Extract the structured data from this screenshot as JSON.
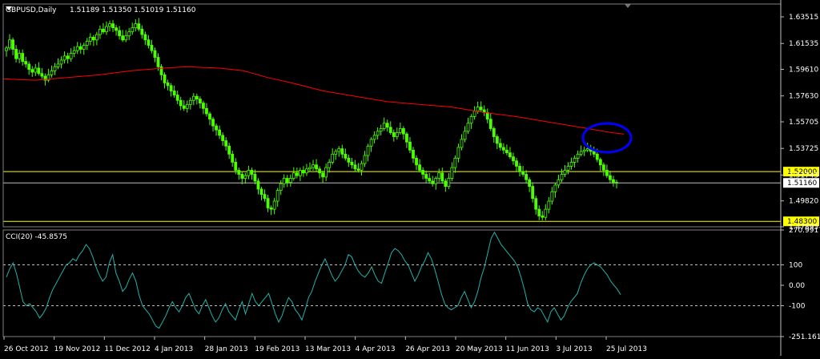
{
  "header": {
    "symbol_label": "GBPUSD,Daily",
    "ohlc": "1.51189 1.51350 1.51019 1.51160",
    "cci_label": "CCI(20) -45.8575"
  },
  "colors": {
    "background": "#000000",
    "candle": "#4cff00",
    "ma": "#ff0000",
    "hline": "#ffff00",
    "cci": "#20b2aa",
    "grid": "#c0c0c0",
    "text": "#ffffff",
    "circle": "#0000ff"
  },
  "chart_data": [
    {
      "type": "candlestick",
      "title": "GBPUSD,Daily",
      "x_tick_labels": [
        "26 Oct 2012",
        "19 Nov 2012",
        "11 Dec 2012",
        "4 Jan 2013",
        "28 Jan 2013",
        "19 Feb 2013",
        "13 Mar 2013",
        "4 Apr 2013",
        "26 Apr 2013",
        "20 May 2013",
        "11 Jun 2013",
        "3 Jul 2013",
        "25 Jul 2013"
      ],
      "y_tick_labels": [
        "1.63515",
        "1.61535",
        "1.59610",
        "1.57630",
        "1.55705",
        "1.53725",
        "1.51745",
        "1.49820",
        "1.47895"
      ],
      "ylim": [
        1.47895,
        1.6435
      ],
      "close_series": [
        1.612,
        1.618,
        1.611,
        1.604,
        1.608,
        1.602,
        1.6,
        1.596,
        1.594,
        1.597,
        1.593,
        1.591,
        1.588,
        1.592,
        1.595,
        1.598,
        1.6,
        1.603,
        1.606,
        1.604,
        1.608,
        1.61,
        1.613,
        1.611,
        1.614,
        1.617,
        1.62,
        1.618,
        1.622,
        1.626,
        1.624,
        1.628,
        1.63,
        1.627,
        1.625,
        1.621,
        1.618,
        1.621,
        1.624,
        1.627,
        1.63,
        1.626,
        1.622,
        1.618,
        1.614,
        1.61,
        1.605,
        1.598,
        1.592,
        1.586,
        1.584,
        1.58,
        1.577,
        1.573,
        1.569,
        1.567,
        1.57,
        1.573,
        1.576,
        1.574,
        1.571,
        1.567,
        1.563,
        1.559,
        1.554,
        1.551,
        1.547,
        1.543,
        1.539,
        1.533,
        1.527,
        1.521,
        1.518,
        1.515,
        1.517,
        1.521,
        1.518,
        1.513,
        1.507,
        1.503,
        1.5,
        1.493,
        1.492,
        1.498,
        1.506,
        1.511,
        1.515,
        1.512,
        1.515,
        1.519,
        1.517,
        1.521,
        1.519,
        1.522,
        1.523,
        1.525,
        1.522,
        1.519,
        1.516,
        1.523,
        1.527,
        1.533,
        1.535,
        1.537,
        1.533,
        1.53,
        1.527,
        1.525,
        1.522,
        1.521,
        1.526,
        1.532,
        1.539,
        1.544,
        1.547,
        1.55,
        1.552,
        1.556,
        1.553,
        1.549,
        1.546,
        1.549,
        1.552,
        1.548,
        1.542,
        1.536,
        1.53,
        1.525,
        1.521,
        1.518,
        1.515,
        1.513,
        1.511,
        1.515,
        1.519,
        1.513,
        1.509,
        1.515,
        1.523,
        1.53,
        1.538,
        1.544,
        1.55,
        1.556,
        1.561,
        1.565,
        1.568,
        1.566,
        1.564,
        1.559,
        1.552,
        1.546,
        1.541,
        1.538,
        1.536,
        1.534,
        1.531,
        1.528,
        1.524,
        1.52,
        1.518,
        1.514,
        1.509,
        1.5,
        1.492,
        1.487,
        1.486,
        1.492,
        1.498,
        1.505,
        1.51,
        1.514,
        1.518,
        1.521,
        1.524,
        1.527,
        1.53,
        1.533,
        1.535,
        1.536,
        1.537,
        1.535,
        1.533,
        1.529,
        1.525,
        1.521,
        1.517,
        1.514,
        1.512,
        1.5116
      ],
      "moving_average": [
        {
          "x": 0,
          "y": 1.589
        },
        {
          "x": 40,
          "y": 1.588
        },
        {
          "x": 80,
          "y": 1.59
        },
        {
          "x": 120,
          "y": 1.592
        },
        {
          "x": 160,
          "y": 1.595
        },
        {
          "x": 200,
          "y": 1.597
        },
        {
          "x": 230,
          "y": 1.598
        },
        {
          "x": 270,
          "y": 1.597
        },
        {
          "x": 300,
          "y": 1.595
        },
        {
          "x": 330,
          "y": 1.59
        },
        {
          "x": 360,
          "y": 1.586
        },
        {
          "x": 400,
          "y": 1.58
        },
        {
          "x": 440,
          "y": 1.576
        },
        {
          "x": 480,
          "y": 1.572
        },
        {
          "x": 520,
          "y": 1.57
        },
        {
          "x": 560,
          "y": 1.568
        },
        {
          "x": 600,
          "y": 1.564
        },
        {
          "x": 640,
          "y": 1.561
        },
        {
          "x": 680,
          "y": 1.557
        },
        {
          "x": 720,
          "y": 1.553
        },
        {
          "x": 760,
          "y": 1.549
        },
        {
          "x": 775,
          "y": 1.548
        }
      ],
      "hlines": [
        {
          "value": 1.52,
          "label": "1.52000",
          "color": "#ffff00"
        },
        {
          "value": 1.5116,
          "label": "1.51160",
          "color": "#c0c0c0"
        },
        {
          "value": 1.483,
          "label": "1.48300",
          "color": "#ffff00"
        }
      ]
    },
    {
      "type": "line",
      "title": "CCI(20) -45.8575",
      "y_tick_labels": [
        "270.9917",
        "100",
        "0.00",
        "-100",
        "-251.1611"
      ],
      "ylim": [
        -251.1611,
        270.9917
      ],
      "dashed_levels": [
        100,
        -100
      ],
      "values": [
        40,
        80,
        110,
        60,
        -10,
        -80,
        -100,
        -90,
        -110,
        -130,
        -160,
        -140,
        -110,
        -60,
        -20,
        10,
        40,
        70,
        100,
        110,
        130,
        120,
        150,
        170,
        200,
        180,
        140,
        90,
        50,
        20,
        40,
        110,
        150,
        60,
        20,
        -30,
        -10,
        30,
        60,
        20,
        -50,
        -100,
        -120,
        -140,
        -170,
        -200,
        -210,
        -180,
        -150,
        -110,
        -80,
        -110,
        -130,
        -100,
        -60,
        -40,
        -80,
        -120,
        -140,
        -100,
        -70,
        -110,
        -150,
        -180,
        -160,
        -120,
        -90,
        -130,
        -150,
        -170,
        -120,
        -80,
        -140,
        -90,
        -40,
        -80,
        -100,
        -80,
        -60,
        -40,
        -90,
        -140,
        -180,
        -150,
        -100,
        -60,
        -80,
        -120,
        -140,
        -170,
        -120,
        -60,
        -30,
        20,
        60,
        100,
        130,
        90,
        50,
        20,
        40,
        70,
        100,
        150,
        140,
        100,
        70,
        50,
        40,
        60,
        90,
        50,
        20,
        10,
        60,
        110,
        160,
        180,
        170,
        150,
        120,
        100,
        60,
        20,
        50,
        90,
        120,
        160,
        130,
        80,
        20,
        -40,
        -90,
        -110,
        -120,
        -110,
        -100,
        -60,
        -30,
        -70,
        -110,
        -80,
        -30,
        40,
        90,
        160,
        230,
        260,
        230,
        200,
        180,
        160,
        140,
        120,
        90,
        40,
        -20,
        -90,
        -120,
        -130,
        -110,
        -120,
        -150,
        -180,
        -130,
        -110,
        -140,
        -170,
        -150,
        -110,
        -80,
        -60,
        -40,
        10,
        50,
        80,
        100,
        110,
        100,
        90,
        70,
        50,
        20,
        0,
        -20,
        -46
      ]
    }
  ]
}
